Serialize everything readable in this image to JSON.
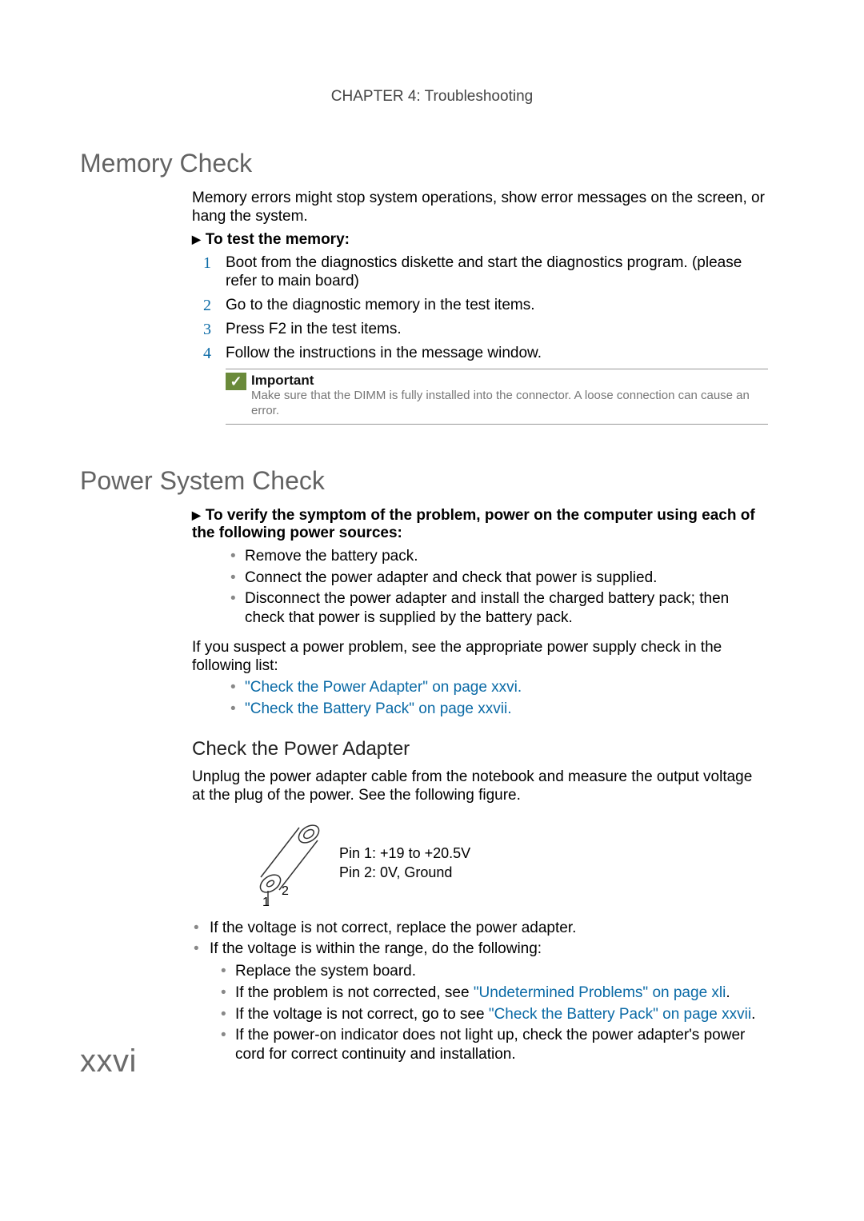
{
  "header": {
    "chapter": "CHAPTER 4: Troubleshooting"
  },
  "section1": {
    "title": "Memory Check",
    "intro": "Memory errors might stop system operations, show error messages on the screen, or hang the system.",
    "proc_lead": "To test the memory:",
    "steps": [
      "Boot from the diagnostics diskette and start the diagnostics program. (please refer to main board)",
      "Go to the diagnostic memory in the test items.",
      "Press F2 in the test items.",
      "Follow the instructions in the message window."
    ],
    "callout": {
      "title": "Important",
      "body": "Make sure that the DIMM is fully installed into the connector. A loose connection can cause an error."
    }
  },
  "section2": {
    "title": "Power System Check",
    "proc_lead": "To verify the symptom of the problem, power on the computer using each of the following power sources:",
    "bullets_a": [
      "Remove the battery pack.",
      "Connect the power adapter and check that power is supplied.",
      "Disconnect the power adapter and install the charged battery pack; then check that power is supplied by the battery pack."
    ],
    "suspect_lead": "If you suspect a power problem, see the appropriate power supply check in the following list:",
    "links": [
      "\"Check the Power Adapter\" on page xxvi.",
      "\"Check the Battery Pack\" on page xxvii."
    ],
    "sub": {
      "title": "Check the Power Adapter",
      "intro": "Unplug the power adapter cable from the notebook and measure the output voltage at the plug of the power. See the following figure.",
      "pins": {
        "pin1": "Pin 1: +19 to +20.5V",
        "pin2": "Pin 2: 0V, Ground"
      },
      "bullets_b": [
        "If the voltage is not correct, replace the power adapter.",
        "If the voltage is within the range, do the following:"
      ],
      "bullets_c": {
        "c1": "Replace the system board.",
        "c2a": "If the problem is not corrected, see ",
        "c2link": "\"Undetermined Problems\" on page xli",
        "c2b": ".",
        "c3a": "If the voltage is not correct, go to see ",
        "c3link": "\"Check the Battery Pack\" on page xxvii",
        "c3b": ".",
        "c4": "If the power-on indicator does not light up, check the power adapter's power cord for correct continuity and installation."
      }
    }
  },
  "page_number": "xxvi"
}
